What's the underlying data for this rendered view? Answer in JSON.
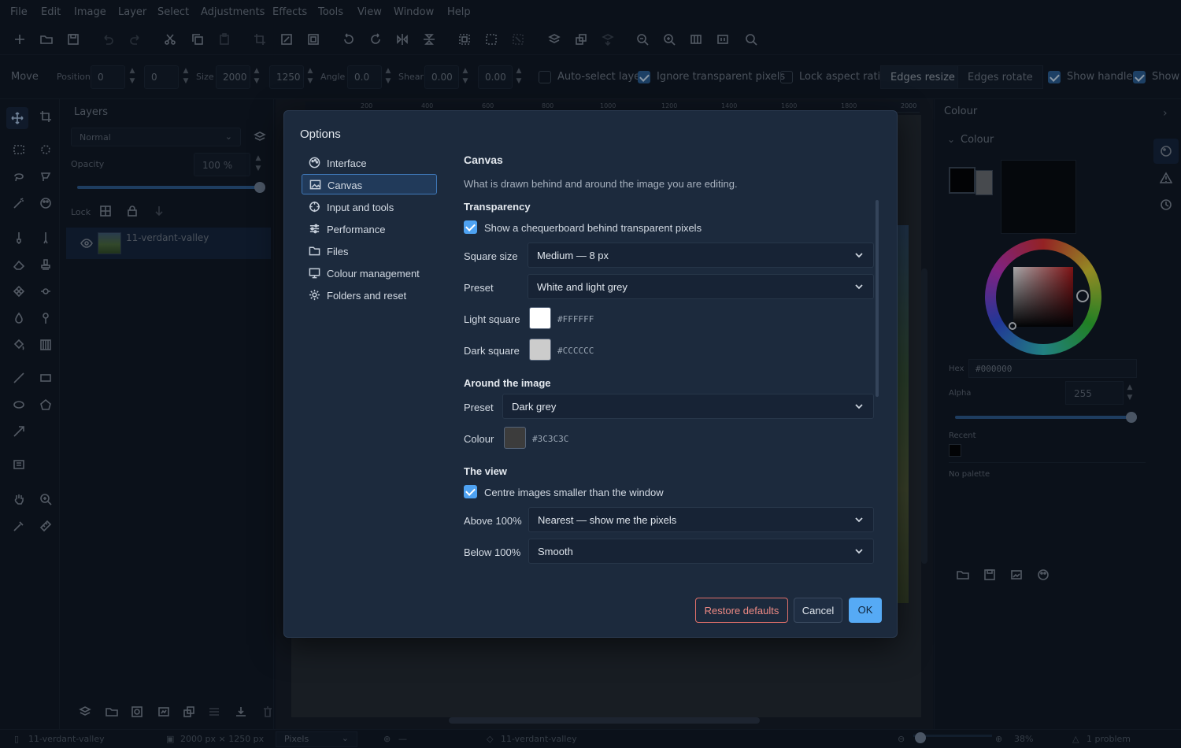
{
  "menubar": [
    "File",
    "Edit",
    "Image",
    "Layer",
    "Select",
    "Adjustments",
    "Effects",
    "Tools",
    "View",
    "Window",
    "Help"
  ],
  "optionsbar": {
    "tool": "Move",
    "position_label": "Position",
    "pos_x": "0",
    "pos_y": "0",
    "size_label": "Size",
    "size_w": "2000",
    "size_h": "1250",
    "angle_label": "Angle",
    "angle": "0.0",
    "shear_label": "Shear",
    "shear_x": "0.00",
    "shear_y": "0.00",
    "auto_select": "Auto-select layer",
    "ignore_transparent": "Ignore transparent pixels",
    "lock_aspect": "Lock aspect ratio",
    "edges_resize": "Edges resize",
    "edges_rotate": "Edges rotate",
    "show_handles": "Show handles",
    "show_more": "Show r"
  },
  "layers": {
    "title": "Layers",
    "blend_mode": "Normal",
    "opacity_label": "Opacity",
    "opacity_value": "100 %",
    "opacity": 1.0,
    "lock_label": "Lock",
    "layer_name": "11-verdant-valley"
  },
  "ruler": [
    "200",
    "400",
    "600",
    "800",
    "1000",
    "1200",
    "1400",
    "1600",
    "1800",
    "2000"
  ],
  "colour_panel": {
    "title": "Colour",
    "section": "Colour",
    "hex_label": "Hex",
    "hex_value": "#000000",
    "alpha_label": "Alpha",
    "alpha_value": "255",
    "alpha": 1.0,
    "recent_label": "Recent",
    "palette_text": "No palette"
  },
  "status": {
    "file": "11-verdant-valley",
    "dimensions": "2000 px × 1250 px",
    "units": "Pixels",
    "cursor": "—",
    "layer": "11-verdant-valley",
    "zoom": "38%",
    "problems": "1 problem"
  },
  "dialog": {
    "title": "Options",
    "nav": [
      {
        "label": "Interface",
        "icon": "palette-icon"
      },
      {
        "label": "Canvas",
        "icon": "image-icon"
      },
      {
        "label": "Input and tools",
        "icon": "crosshair-icon"
      },
      {
        "label": "Performance",
        "icon": "sliders-icon"
      },
      {
        "label": "Files",
        "icon": "folder-icon"
      },
      {
        "label": "Colour management",
        "icon": "monitor-icon"
      },
      {
        "label": "Folders and reset",
        "icon": "gear-icon"
      }
    ],
    "section_title": "Canvas",
    "section_desc": "What is drawn behind and around the image you are editing.",
    "transparency": {
      "heading": "Transparency",
      "checkbox_label": "Show a chequerboard behind transparent pixels",
      "square_size_label": "Square size",
      "square_size_value": "Medium — 8 px",
      "preset_label": "Preset",
      "preset_value": "White and light grey",
      "light_label": "Light square",
      "light_hex": "#FFFFFF",
      "light_color": "#FFFFFF",
      "dark_label": "Dark square",
      "dark_hex": "#CCCCCC",
      "dark_color": "#CCCCCC"
    },
    "around": {
      "heading": "Around the image",
      "preset_label": "Preset",
      "preset_value": "Dark grey",
      "colour_label": "Colour",
      "colour_hex": "#3C3C3C",
      "colour_color": "#3C3C3C"
    },
    "view": {
      "heading": "The view",
      "checkbox_label": "Centre images smaller than the window",
      "above_label": "Above 100%",
      "above_value": "Nearest — show me the pixels",
      "below_label": "Below 100%",
      "below_value": "Smooth"
    },
    "buttons": {
      "restore": "Restore defaults",
      "cancel": "Cancel",
      "ok": "OK"
    }
  }
}
